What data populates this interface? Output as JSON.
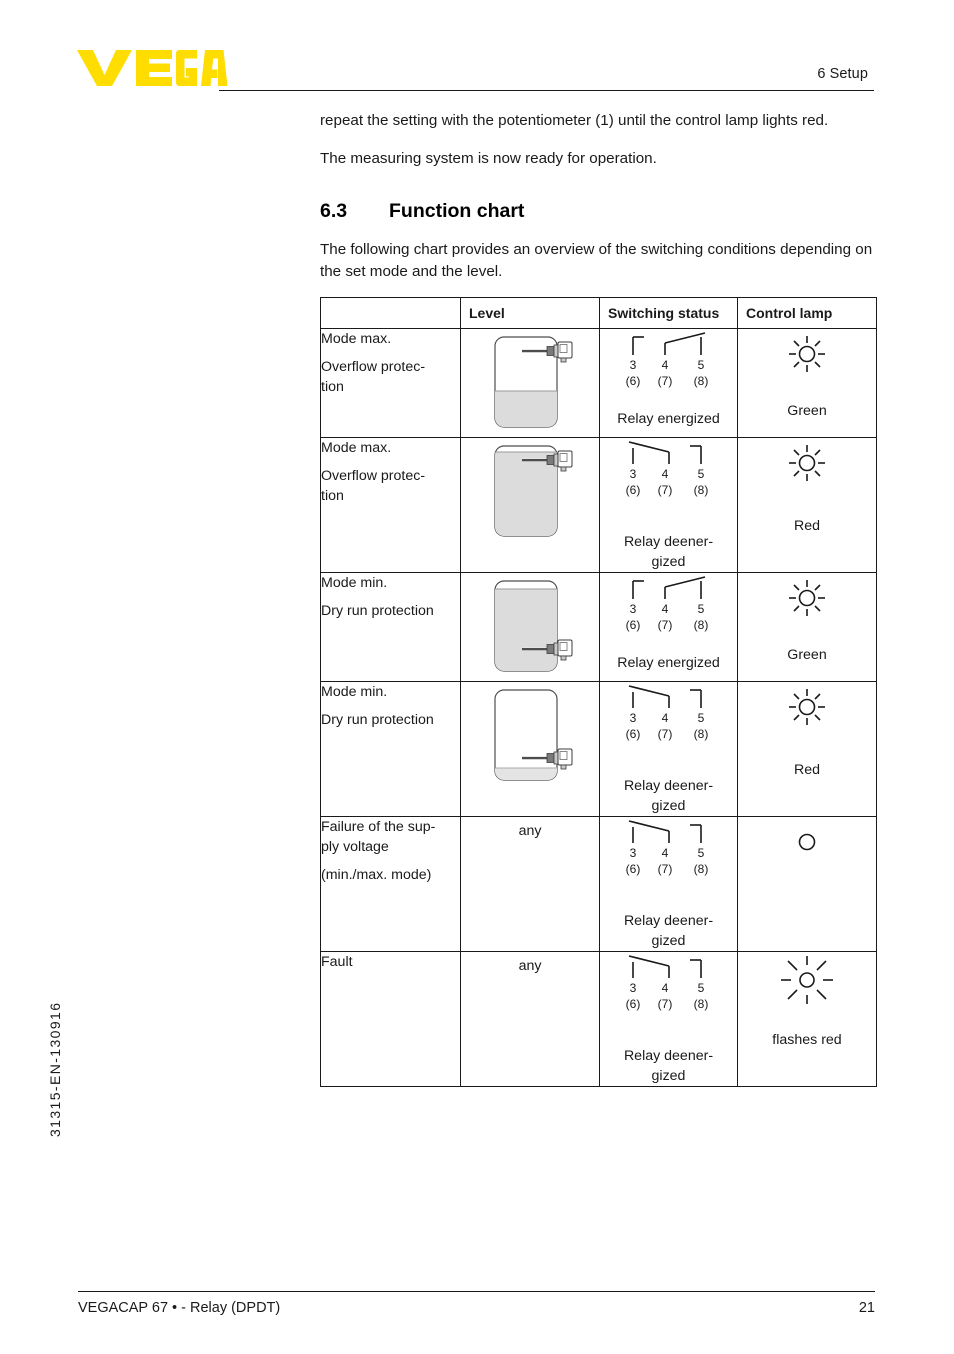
{
  "header": {
    "logo_text": "VEGA",
    "logo_color": "#FFDD00",
    "section_title": "6 Setup"
  },
  "body": {
    "intro_paragraph": "repeat the setting with the potentiometer (1) until the control lamp lights red.",
    "ready_paragraph": "The measuring system is now ready for operation.",
    "heading_number": "6.3",
    "heading_text": "Function chart",
    "lead_paragraph": "The following chart provides an overview of the switching conditions depending on the set mode and the level."
  },
  "table": {
    "columns": [
      "",
      "Level",
      "Switching status",
      "Control lamp"
    ],
    "terminal_labels": {
      "top": [
        "3",
        "4",
        "5"
      ],
      "bottom": [
        "(6)",
        "(7)",
        "(8)"
      ]
    },
    "rows": [
      {
        "mode_line1": "Mode max.",
        "mode_line2": "Overflow protec-­ tion",
        "mode_line2_a": "Overflow protec-",
        "mode_line2_b": "tion",
        "level_type": "vessel",
        "level_fill": "low",
        "probe_position": "top",
        "probe_covered": false,
        "contact_state": "energized",
        "relay_label": "Relay energized",
        "lamp_state": "on",
        "lamp_label": "Green"
      },
      {
        "mode_line1": "Mode max.",
        "mode_line2_a": "Overflow protec-",
        "mode_line2_b": "tion",
        "level_type": "vessel",
        "level_fill": "full",
        "probe_position": "top",
        "probe_covered": true,
        "contact_state": "deenergized",
        "relay_label_a": "Relay deener-",
        "relay_label_b": "gized",
        "lamp_state": "on",
        "lamp_label": "Red"
      },
      {
        "mode_line1": "Mode min.",
        "mode_line2_a": "Dry run protection",
        "mode_line2_b": "",
        "level_type": "vessel",
        "level_fill": "full",
        "probe_position": "bottom",
        "probe_covered": true,
        "contact_state": "energized",
        "relay_label": "Relay energized",
        "lamp_state": "on",
        "lamp_label": "Green"
      },
      {
        "mode_line1": "Mode min.",
        "mode_line2_a": "Dry run protection",
        "mode_line2_b": "",
        "level_type": "vessel",
        "level_fill": "empty",
        "probe_position": "bottom",
        "probe_covered": false,
        "contact_state": "deenergized",
        "relay_label_a": "Relay deener-",
        "relay_label_b": "gized",
        "lamp_state": "on",
        "lamp_label": "Red"
      },
      {
        "mode_line1": "Failure of the sup-",
        "mode_line1b": "ply voltage",
        "mode_line2_a": "(min./max. mode)",
        "mode_line2_b": "",
        "level_type": "text",
        "level_text": "any",
        "contact_state": "deenergized",
        "relay_label_a": "Relay deener-",
        "relay_label_b": "gized",
        "lamp_state": "off",
        "lamp_label": ""
      },
      {
        "mode_line1": "Fault",
        "mode_line1b": "",
        "mode_line2_a": "",
        "mode_line2_b": "",
        "level_type": "text",
        "level_text": "any",
        "contact_state": "deenergized",
        "relay_label_a": "Relay deener-",
        "relay_label_b": "gized",
        "lamp_state": "flashing",
        "lamp_label": "flashes red"
      }
    ]
  },
  "footer": {
    "doc_code": "31315-EN-130916",
    "product_line": "VEGACAP 67 • - Relay (DPDT)",
    "page_number": "21"
  }
}
